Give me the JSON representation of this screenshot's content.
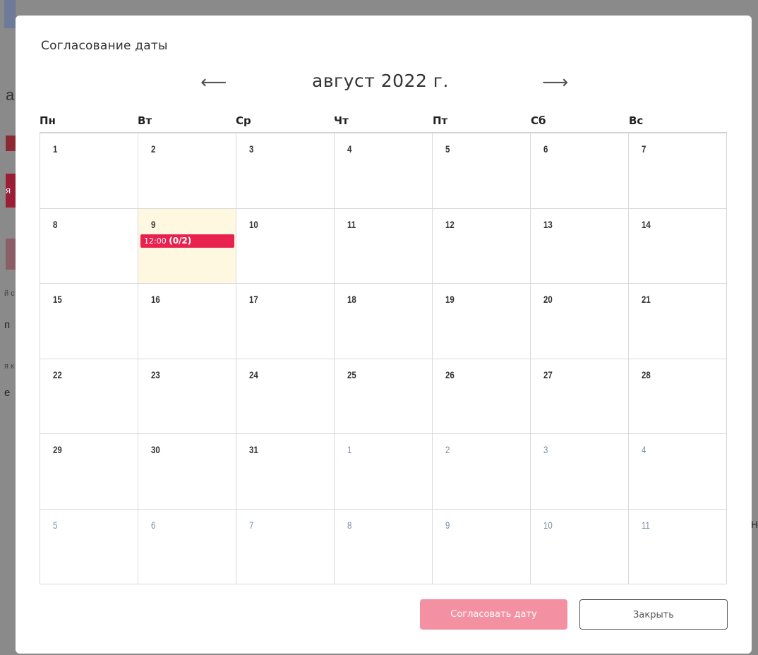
{
  "background": {
    "fragments": [
      "а",
      "я",
      "й с",
      "п",
      "я к",
      "е",
      "Н"
    ]
  },
  "modal": {
    "title": "Согласование даты",
    "nav": {
      "prev_icon": "arrow-left-icon",
      "next_icon": "arrow-right-icon",
      "prev_glyph": "⟵",
      "next_glyph": "⟶",
      "month_label": "август 2022 г."
    },
    "weekdays": [
      "Пн",
      "Вт",
      "Ср",
      "Чт",
      "Пт",
      "Сб",
      "Вс"
    ],
    "weeks": [
      [
        {
          "d": "1"
        },
        {
          "d": "2"
        },
        {
          "d": "3"
        },
        {
          "d": "4"
        },
        {
          "d": "5"
        },
        {
          "d": "6"
        },
        {
          "d": "7"
        }
      ],
      [
        {
          "d": "8"
        },
        {
          "d": "9",
          "today": true,
          "event": {
            "time": "12:00",
            "count": "(0/2)"
          }
        },
        {
          "d": "10"
        },
        {
          "d": "11"
        },
        {
          "d": "12"
        },
        {
          "d": "13"
        },
        {
          "d": "14"
        }
      ],
      [
        {
          "d": "15"
        },
        {
          "d": "16"
        },
        {
          "d": "17"
        },
        {
          "d": "18"
        },
        {
          "d": "19"
        },
        {
          "d": "20"
        },
        {
          "d": "21"
        }
      ],
      [
        {
          "d": "22"
        },
        {
          "d": "23"
        },
        {
          "d": "24"
        },
        {
          "d": "25"
        },
        {
          "d": "26"
        },
        {
          "d": "27"
        },
        {
          "d": "28"
        }
      ],
      [
        {
          "d": "29"
        },
        {
          "d": "30"
        },
        {
          "d": "31"
        },
        {
          "d": "1",
          "other": true
        },
        {
          "d": "2",
          "other": true
        },
        {
          "d": "3",
          "other": true
        },
        {
          "d": "4",
          "other": true
        }
      ],
      [
        {
          "d": "5",
          "other": true
        },
        {
          "d": "6",
          "other": true
        },
        {
          "d": "7",
          "other": true
        },
        {
          "d": "8",
          "other": true
        },
        {
          "d": "9",
          "other": true
        },
        {
          "d": "10",
          "other": true
        },
        {
          "d": "11",
          "other": true
        }
      ]
    ],
    "buttons": {
      "agree_label": "Согласовать дату",
      "close_label": "Закрыть"
    }
  },
  "colors": {
    "event_bg": "#e8214f",
    "today_bg": "#fff8e1",
    "agree_button_bg": "#f391a2",
    "other_month_text": "#7a8fa6"
  }
}
